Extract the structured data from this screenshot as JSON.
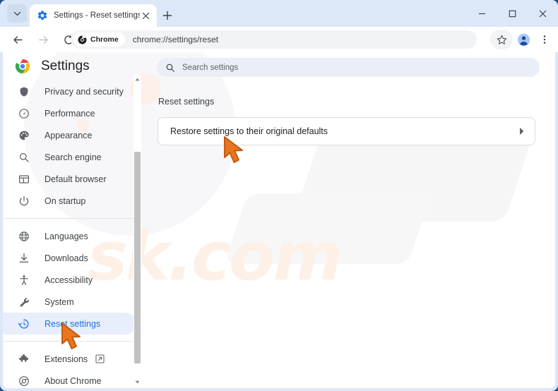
{
  "window": {
    "controls": {
      "minimize": "minimize-button",
      "maximize": "maximize-button",
      "close": "close-button"
    }
  },
  "tabstrip": {
    "tab_search_label": "Search tabs",
    "tab": {
      "title": "Settings - Reset settings",
      "favicon": "settings-gear-icon",
      "close_label": "Close tab"
    },
    "new_tab_label": "New Tab"
  },
  "toolbar": {
    "back_label": "Back",
    "forward_label": "Forward",
    "reload_label": "Reload",
    "chrome_pill_label": "Chrome",
    "url": "chrome://settings/reset",
    "bookmark_label": "Bookmark this tab",
    "profile_label": "Profile",
    "menu_label": "Customize and control Google Chrome"
  },
  "sidebar": {
    "title": "Settings",
    "logo": "chrome-logo-icon",
    "groups": [
      {
        "items": [
          {
            "label": "Privacy and security",
            "icon": "shield-icon",
            "selected": false
          },
          {
            "label": "Performance",
            "icon": "speedometer-icon",
            "selected": false
          },
          {
            "label": "Appearance",
            "icon": "palette-icon",
            "selected": false
          },
          {
            "label": "Search engine",
            "icon": "magnifier-icon",
            "selected": false
          },
          {
            "label": "Default browser",
            "icon": "browser-window-icon",
            "selected": false
          },
          {
            "label": "On startup",
            "icon": "power-icon",
            "selected": false
          }
        ]
      },
      {
        "items": [
          {
            "label": "Languages",
            "icon": "globe-icon",
            "selected": false
          },
          {
            "label": "Downloads",
            "icon": "download-icon",
            "selected": false
          },
          {
            "label": "Accessibility",
            "icon": "accessibility-icon",
            "selected": false
          },
          {
            "label": "System",
            "icon": "wrench-icon",
            "selected": false
          },
          {
            "label": "Reset settings",
            "icon": "history-clock-icon",
            "selected": true
          }
        ]
      },
      {
        "items": [
          {
            "label": "Extensions",
            "icon": "puzzle-icon",
            "selected": false,
            "external": true
          },
          {
            "label": "About Chrome",
            "icon": "chrome-outline-icon",
            "selected": false
          }
        ]
      }
    ]
  },
  "main": {
    "search": {
      "placeholder": "Search settings",
      "icon": "search-icon"
    },
    "section_title": "Reset settings",
    "card": {
      "label": "Restore settings to their original defaults",
      "chevron": "chevron-right-icon"
    }
  },
  "annotations": {
    "cursor_main": "orange-cursor-arrow",
    "cursor_sidebar": "orange-cursor-arrow"
  },
  "watermark": {
    "text": "sk.com"
  },
  "colors": {
    "accent_blue": "#1a73e8",
    "selected_bg": "#e8eefc",
    "tabstrip_bg": "#dce7f7",
    "omnibox_bg": "#f1f3f4",
    "searchbar_bg": "#eaeff7",
    "window_border": "#1f4e87",
    "cursor_orange": "#e8761f"
  }
}
